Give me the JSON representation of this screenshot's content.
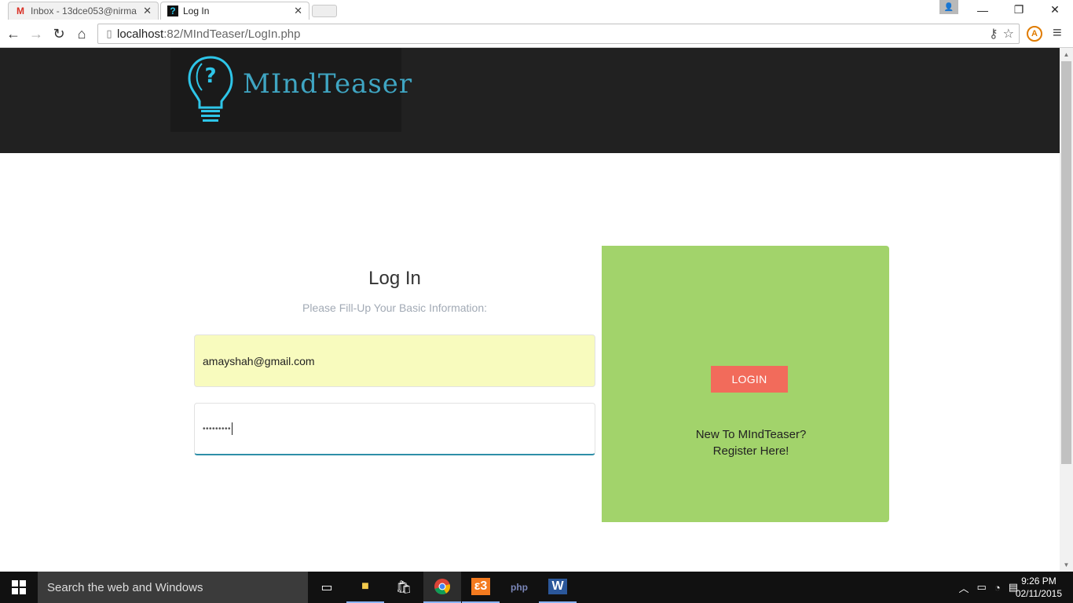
{
  "browser": {
    "tabs": [
      {
        "title": "Inbox - 13dce053@nirma",
        "icon": "gmail-icon"
      },
      {
        "title": "Log In",
        "icon": "mindteaser-favicon"
      }
    ],
    "url_host": "localhost",
    "url_rest": ":82/MIndTeaser/LogIn.php"
  },
  "page": {
    "logo_text": "MIndTeaser",
    "login_title": "Log In",
    "login_subtitle": "Please Fill-Up Your Basic Information:",
    "email_value": "amayshah@gmail.com",
    "password_mask": "•••••••••",
    "login_button": "LOGIN",
    "register_line1": "New To MIndTeaser?",
    "register_line2": "Register Here!"
  },
  "taskbar": {
    "search_placeholder": "Search the web and Windows",
    "time": "9:26 PM",
    "date": "02/11/2015"
  },
  "colors": {
    "header": "#212121",
    "green_panel": "#a2d36b",
    "login_button": "#f26b5b",
    "email_autofill": "#f8fbbe",
    "logo_cyan": "#3fa5c2"
  }
}
